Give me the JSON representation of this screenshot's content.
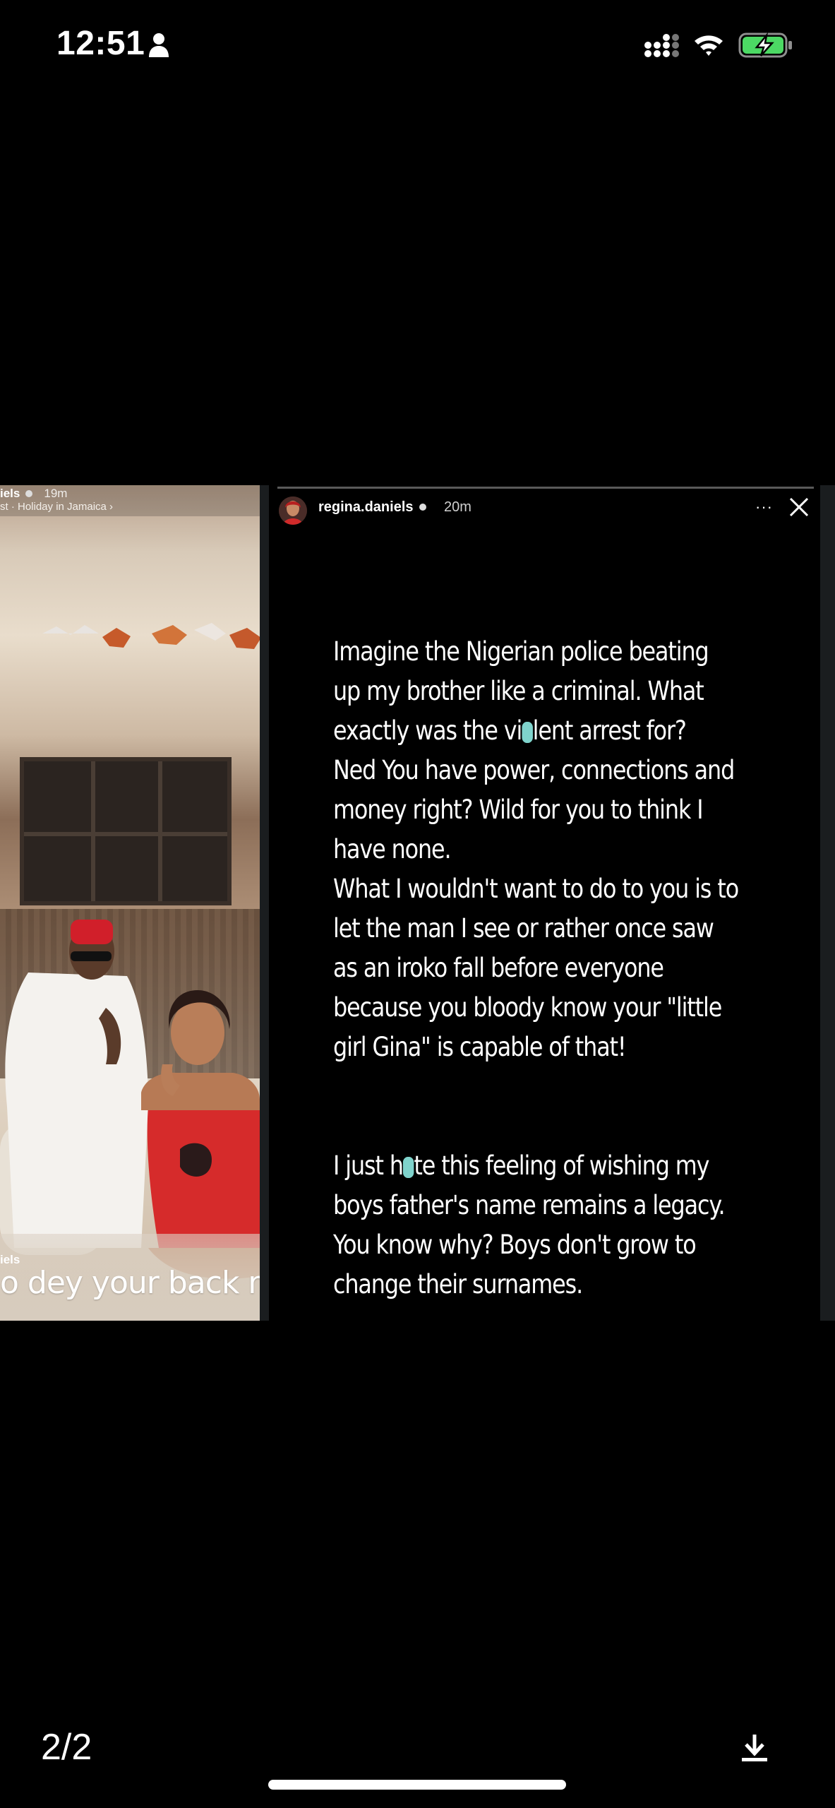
{
  "status_bar": {
    "time": "12:51",
    "icons": [
      "person-icon",
      "signal-icon",
      "wifi-icon",
      "battery-charging-icon"
    ],
    "battery_color": "#4cd964"
  },
  "left_story": {
    "username": "iels",
    "time": "19m",
    "music": "st · Holiday in Jamaica ›",
    "caption_user": "iels",
    "caption": "o dey your back my br"
  },
  "story": {
    "username": "regina.daniels",
    "time": "20m",
    "more_label": "···",
    "text": {
      "p1_l1": "Imagine the Nigerian police beating",
      "p1_l2": "up my brother like a criminal. What",
      "p1_l3a": "exactly was the vi",
      "p1_l3b": "lent arrest for?",
      "p1_l4": "Ned You have power, connections and",
      "p1_l5": "money right? Wild for you to think I",
      "p1_l6": "have none.",
      "p2_l1": "What I wouldn't want to do to you is to",
      "p2_l2": "let the man I see or rather once saw",
      "p2_l3": "as an iroko fall before everyone",
      "p2_l4": "because you bloody know your \"little",
      "p2_l5": "girl Gina\" is capable of that!",
      "p3_l1a": "I just h",
      "p3_l1b": "te this feeling of wishing my",
      "p3_l2": "boys father's name remains a legacy.",
      "p3_l3": "You know why? Boys don't grow to",
      "p3_l4": "change their surnames."
    }
  },
  "bottom_bar": {
    "page_counter": "2/2",
    "download_icon": "download-icon"
  },
  "colors": {
    "background": "#000000",
    "highlight": "#7fd3cc"
  }
}
